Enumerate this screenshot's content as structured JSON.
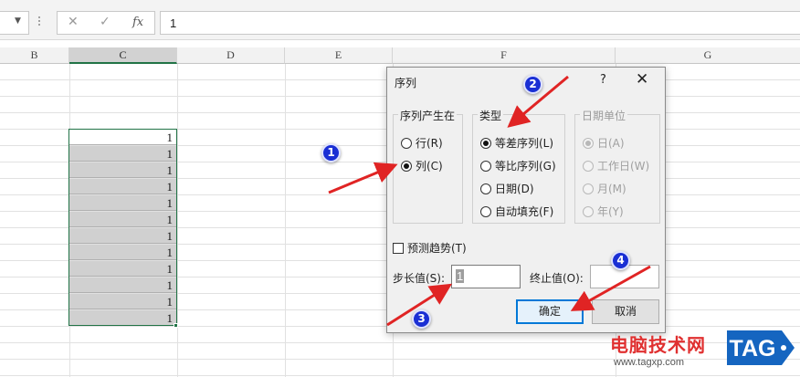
{
  "formula_bar": {
    "cancel_icon": "x-icon",
    "enter_icon": "check-icon",
    "fx_label": "fx",
    "content": "1"
  },
  "columns": [
    "B",
    "C",
    "D",
    "E",
    "F",
    "G"
  ],
  "selected_column": "C",
  "column_c_values": [
    "1",
    "1",
    "1",
    "1",
    "1",
    "1",
    "1",
    "1",
    "1",
    "1",
    "1",
    "1"
  ],
  "dialog": {
    "title": "序列",
    "help_label": "?",
    "close_label": "✕",
    "series_in": {
      "label": "序列产生在",
      "options": [
        "行(R)",
        "列(C)"
      ],
      "selected": "列(C)"
    },
    "type": {
      "label": "类型",
      "options": [
        "等差序列(L)",
        "等比序列(G)",
        "日期(D)",
        "自动填充(F)"
      ],
      "selected": "等差序列(L)"
    },
    "date_unit": {
      "label": "日期单位",
      "options": [
        "日(A)",
        "工作日(W)",
        "月(M)",
        "年(Y)"
      ],
      "selected": "日(A)",
      "disabled": true
    },
    "trend_label": "预测趋势(T)",
    "trend_checked": false,
    "step_label": "步长值(S):",
    "step_value": "1",
    "stop_label": "终止值(O):",
    "stop_value": "",
    "ok_label": "确定",
    "cancel_label": "取消"
  },
  "annotations": {
    "markers": [
      "1",
      "2",
      "3",
      "4"
    ],
    "arrow_color": "#e02424",
    "marker_color": "#1a2fd4"
  },
  "watermark": {
    "text": "电脑技术网",
    "url": "www.tagxp.com",
    "logo_text": "TAG"
  },
  "colors": {
    "accent_green": "#217346",
    "dialog_default_button_border": "#0078d7"
  }
}
